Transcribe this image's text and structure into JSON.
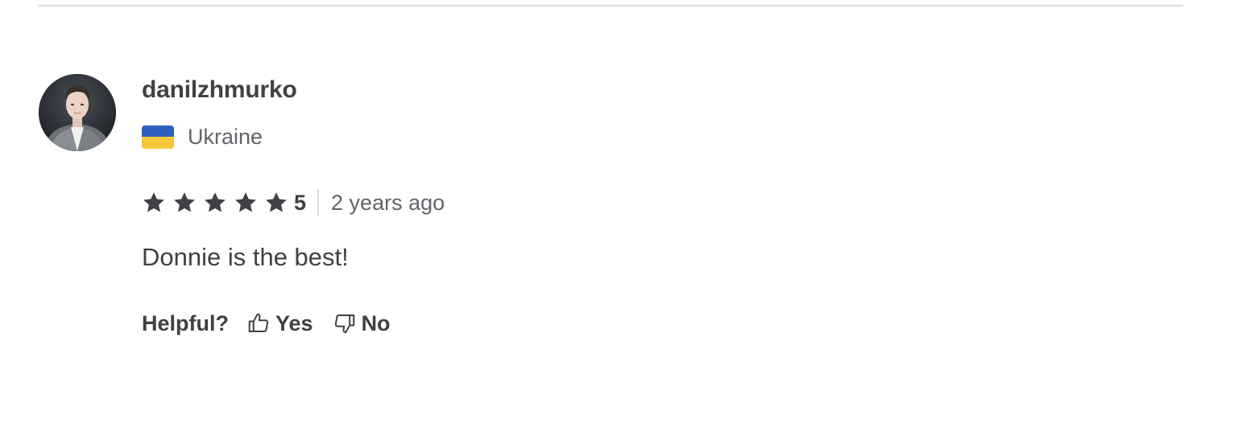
{
  "review": {
    "username": "danilzhmurko",
    "country": {
      "name": "Ukraine",
      "flag_icon": "ukraine-flag-icon",
      "flag_colors": [
        "#2f5fbf",
        "#f6c73b"
      ]
    },
    "rating": {
      "stars_filled": 5,
      "stars_total": 5,
      "value_label": "5",
      "star_color": "#404145"
    },
    "time_ago": "2 years ago",
    "text": "Donnie is the best!",
    "helpful": {
      "label": "Helpful?",
      "yes_label": "Yes",
      "yes_icon": "thumbs-up-icon",
      "no_label": "No",
      "no_icon": "thumbs-down-icon"
    }
  },
  "colors": {
    "text_primary": "#404145",
    "text_secondary": "#62646a",
    "divider": "#dadbdd"
  }
}
